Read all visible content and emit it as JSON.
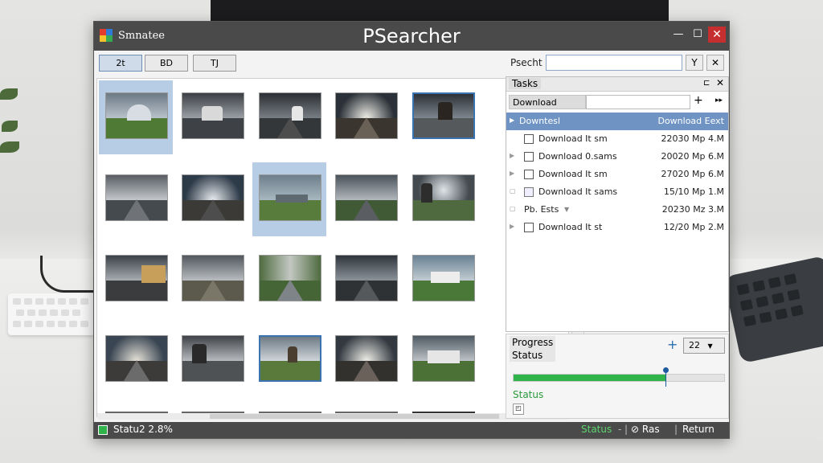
{
  "window": {
    "app_title_small": "Smnatee",
    "app_title": "PSearcher",
    "minimize_glyph": "—",
    "maximize_glyph": "☐",
    "close_glyph": "✕"
  },
  "toolbar": {
    "buttons": [
      "2t",
      "BD",
      "TJ"
    ]
  },
  "search": {
    "label": "Psecht",
    "value": "",
    "btn1": "Y",
    "btn2": "✕"
  },
  "tasks": {
    "title": "Tasks",
    "pin_glyph": "⊏",
    "close_glyph": "✕",
    "combo_label": "Download",
    "add_glyph": "+",
    "menu_glyph": "▸▸",
    "rows": [
      {
        "name": "Downtesl",
        "meta": "Download Eext",
        "selected": true
      },
      {
        "name": "Download It sm",
        "meta": "22030 Mp 4.M"
      },
      {
        "name": "Download 0.sams",
        "meta": "20020 Mp 6.M"
      },
      {
        "name": "Download It sm",
        "meta": "27020 Mp 6.M"
      },
      {
        "name": "Download It sams",
        "meta": "15/10 Mp 1.M"
      },
      {
        "name": "Pb. Ests",
        "meta": "20230 Mz 3.M"
      },
      {
        "name": "Download It st",
        "meta": "12/20 Mp 2.M"
      }
    ]
  },
  "progress": {
    "label_line1": "Progress",
    "label_line2": "Status",
    "add_glyph": "+",
    "select_value": "22",
    "status_text": "Status",
    "fill_fraction": 0.72
  },
  "statusbar": {
    "left_text": "Statu2 2.8%",
    "status": "Status",
    "ras": "Ras",
    "return": "Return"
  },
  "colors": {
    "titlebar": "#4a4a4a",
    "selection": "#6f94c3",
    "progress_green": "#2fb34a",
    "accent_blue": "#3a73b0"
  }
}
